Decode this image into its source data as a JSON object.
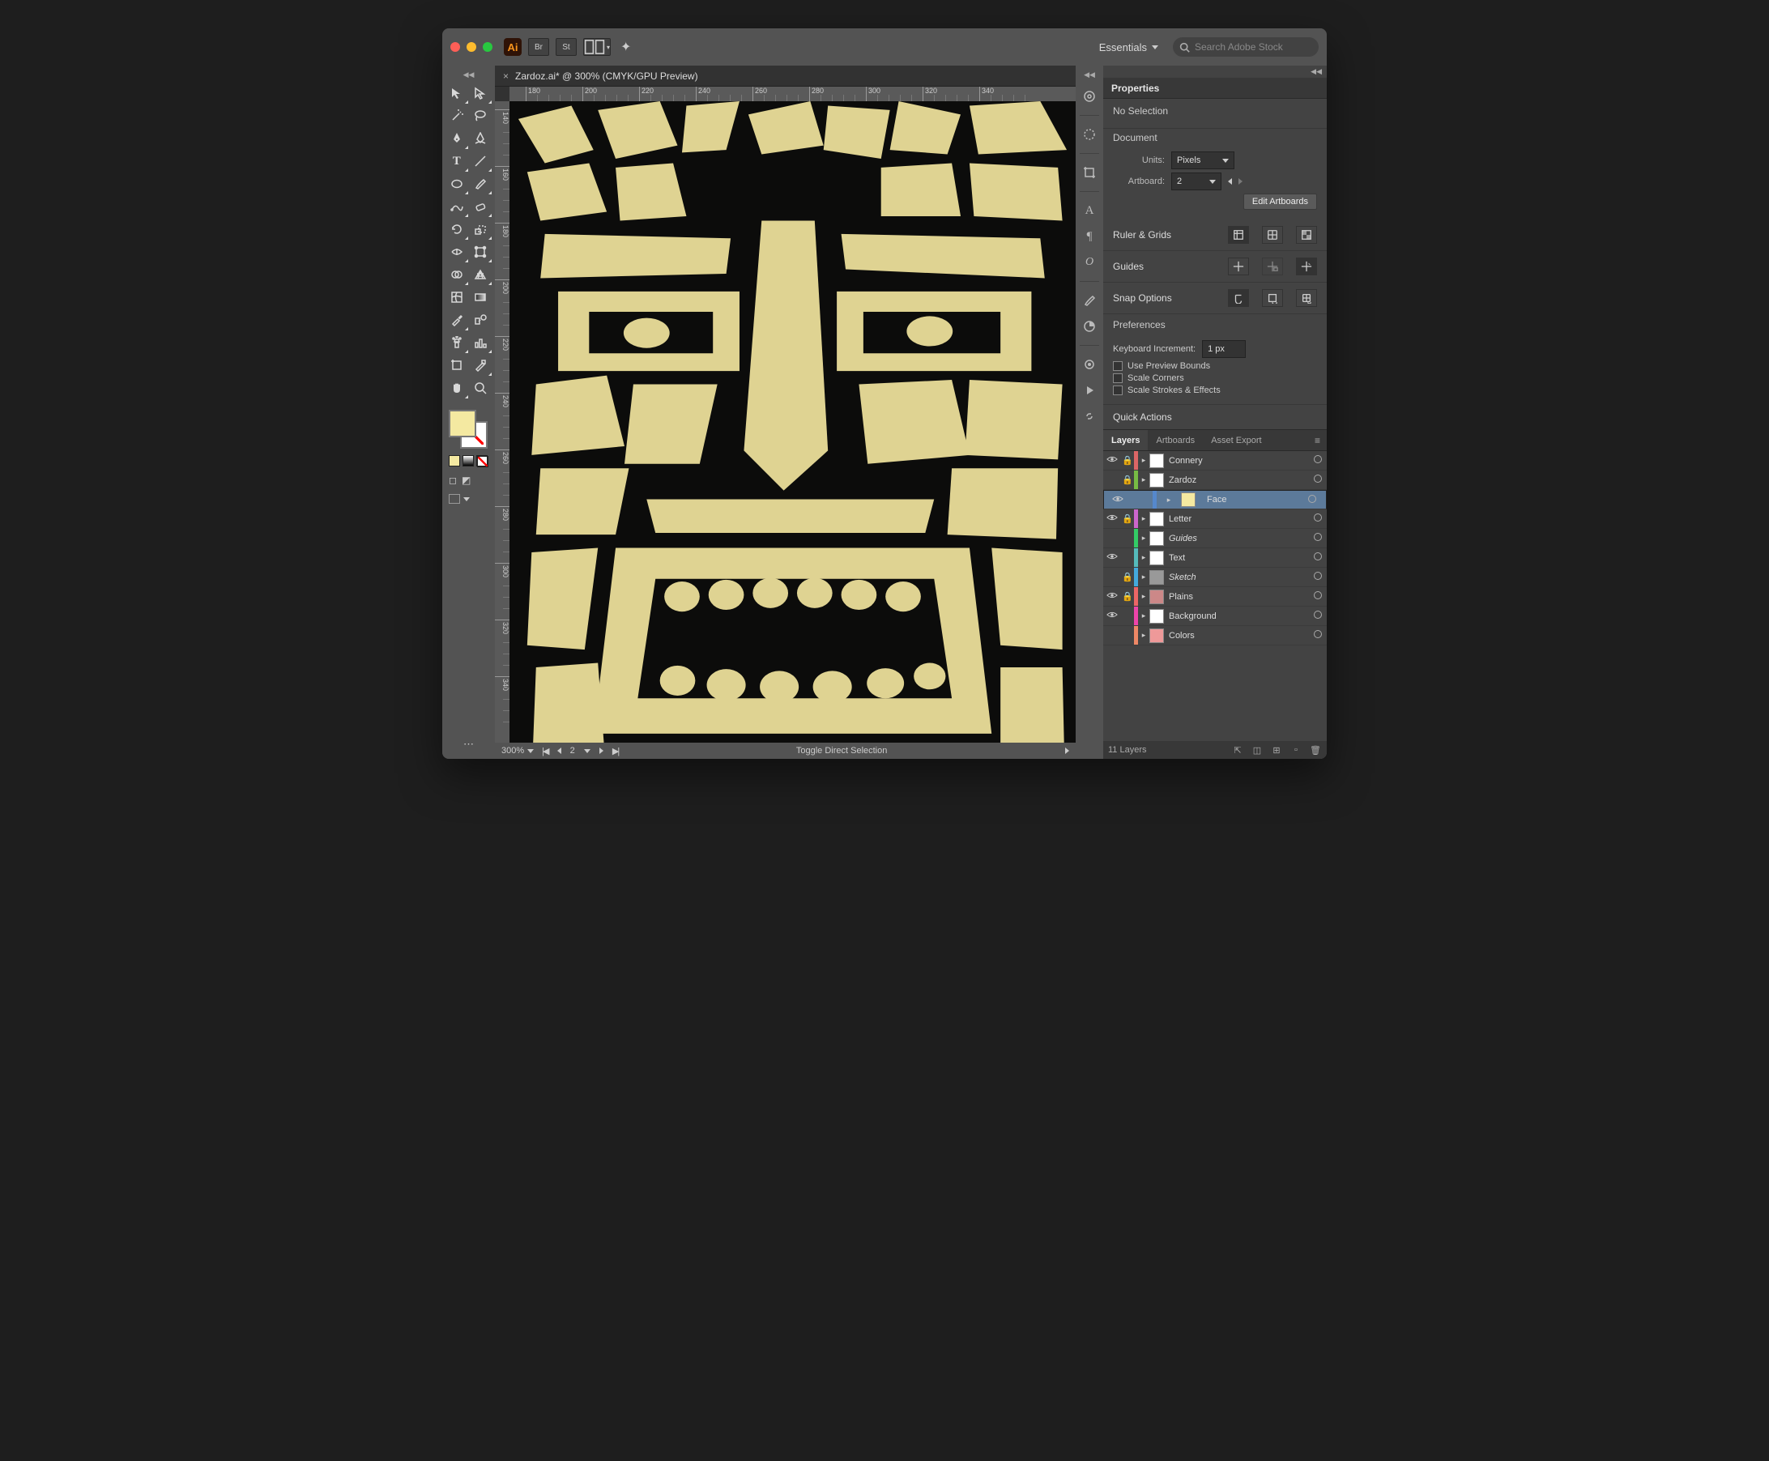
{
  "app": {
    "name": "Ai",
    "workspace": "Essentials",
    "search_placeholder": "Search Adobe Stock"
  },
  "document": {
    "tab_title": "Zardoz.ai* @ 300% (CMYK/GPU Preview)",
    "zoom": "300%",
    "artboard_no": "2"
  },
  "status": {
    "tooltip": "Toggle Direct Selection"
  },
  "rulers": {
    "h": [
      "180",
      "200",
      "220",
      "240",
      "260",
      "280",
      "300",
      "320",
      "340"
    ],
    "v": [
      "140",
      "160",
      "180",
      "200",
      "220",
      "240",
      "260",
      "280",
      "300",
      "320",
      "340"
    ]
  },
  "properties": {
    "title": "Properties",
    "selection": "No Selection",
    "doc_label": "Document",
    "units_label": "Units:",
    "units_value": "Pixels",
    "artboard_label": "Artboard:",
    "artboard_value": "2",
    "edit_artboards": "Edit Artboards",
    "ruler_grids": "Ruler & Grids",
    "guides": "Guides",
    "snap": "Snap Options",
    "prefs": "Preferences",
    "kbd_inc_label": "Keyboard Increment:",
    "kbd_inc_value": "1 px",
    "use_preview": "Use Preview Bounds",
    "scale_corners": "Scale Corners",
    "scale_strokes": "Scale Strokes & Effects",
    "quick": "Quick Actions"
  },
  "layers_panel": {
    "tabs": [
      "Layers",
      "Artboards",
      "Asset Export"
    ],
    "count_label": "11 Layers",
    "layers": [
      {
        "name": "Connery",
        "color": "#d66",
        "locked": true,
        "visible": true,
        "italic": false,
        "selected": false,
        "thumb": "#fff"
      },
      {
        "name": "Zardoz",
        "color": "#7b4",
        "locked": true,
        "visible": false,
        "italic": false,
        "selected": false,
        "thumb": "#fff"
      },
      {
        "name": "Face",
        "color": "#58c",
        "locked": false,
        "visible": true,
        "italic": false,
        "selected": true,
        "thumb": "#f4e9a1"
      },
      {
        "name": "Letter",
        "color": "#c6c",
        "locked": true,
        "visible": true,
        "italic": false,
        "selected": false,
        "thumb": "#fff"
      },
      {
        "name": "Guides",
        "color": "#3c6",
        "locked": false,
        "visible": false,
        "italic": true,
        "selected": false,
        "thumb": "#fff"
      },
      {
        "name": "Text",
        "color": "#5bb",
        "locked": false,
        "visible": true,
        "italic": false,
        "selected": false,
        "thumb": "#fff"
      },
      {
        "name": "Sketch",
        "color": "#4ad",
        "locked": true,
        "visible": false,
        "italic": true,
        "selected": false,
        "thumb": "#999"
      },
      {
        "name": "Plains",
        "color": "#e66",
        "locked": true,
        "visible": true,
        "italic": false,
        "selected": false,
        "thumb": "#c88"
      },
      {
        "name": "Background",
        "color": "#e4a",
        "locked": false,
        "visible": true,
        "italic": false,
        "selected": false,
        "thumb": "#fff"
      },
      {
        "name": "Colors",
        "color": "#e86",
        "locked": false,
        "visible": false,
        "italic": false,
        "selected": false,
        "thumb": "#e99"
      }
    ]
  },
  "colors": {
    "accent": "#f4e9a1"
  }
}
